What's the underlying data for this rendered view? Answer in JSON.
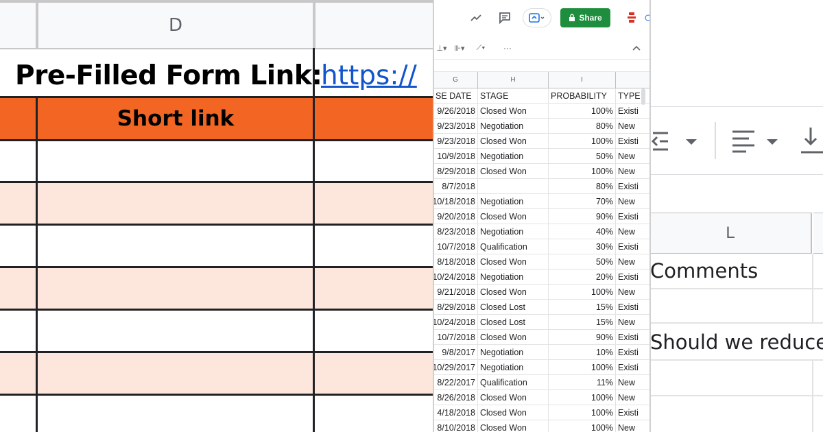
{
  "panel_left": {
    "column_header": "D",
    "title": "Pre-Filled Form Link:",
    "link_text": "https://",
    "header_cell": "Short link",
    "colors": {
      "orange": "#f26522",
      "light_row": "#fde6dc",
      "link": "#1155cc"
    }
  },
  "panel_middle": {
    "share_label": "Share",
    "columns": [
      {
        "letter": "G",
        "header": "SE DATE"
      },
      {
        "letter": "H",
        "header": "STAGE"
      },
      {
        "letter": "I",
        "header": "PROBABILITY"
      },
      {
        "letter": "",
        "header": "TYPE"
      }
    ],
    "rows": [
      {
        "date": "9/26/2018",
        "stage": "Closed Won",
        "prob": "100%",
        "type": "Existi"
      },
      {
        "date": "9/23/2018",
        "stage": "Negotiation",
        "prob": "80%",
        "type": "New"
      },
      {
        "date": "9/23/2018",
        "stage": "Closed Won",
        "prob": "100%",
        "type": "Existi"
      },
      {
        "date": "10/9/2018",
        "stage": "Negotiation",
        "prob": "50%",
        "type": "New"
      },
      {
        "date": "8/29/2018",
        "stage": "Closed Won",
        "prob": "100%",
        "type": "New"
      },
      {
        "date": "8/7/2018",
        "stage": "",
        "prob": "80%",
        "type": "Existi"
      },
      {
        "date": "10/18/2018",
        "stage": "Negotiation",
        "prob": "70%",
        "type": "New"
      },
      {
        "date": "9/20/2018",
        "stage": "Closed Won",
        "prob": "90%",
        "type": "Existi"
      },
      {
        "date": "8/23/2018",
        "stage": "Negotiation",
        "prob": "40%",
        "type": "New"
      },
      {
        "date": "10/7/2018",
        "stage": "Qualification",
        "prob": "30%",
        "type": "Existi"
      },
      {
        "date": "8/18/2018",
        "stage": "Closed Won",
        "prob": "50%",
        "type": "New"
      },
      {
        "date": "10/24/2018",
        "stage": "Negotiation",
        "prob": "20%",
        "type": "Existi"
      },
      {
        "date": "9/21/2018",
        "stage": "Closed Won",
        "prob": "100%",
        "type": "New"
      },
      {
        "date": "8/29/2018",
        "stage": "Closed Lost",
        "prob": "15%",
        "type": "Existi"
      },
      {
        "date": "10/24/2018",
        "stage": "Closed Lost",
        "prob": "15%",
        "type": "New"
      },
      {
        "date": "10/7/2018",
        "stage": "Closed Won",
        "prob": "90%",
        "type": "Existi"
      },
      {
        "date": "9/8/2017",
        "stage": "Negotiation",
        "prob": "10%",
        "type": "Existi"
      },
      {
        "date": "10/29/2017",
        "stage": "Negotiation",
        "prob": "100%",
        "type": "Existi"
      },
      {
        "date": "8/22/2017",
        "stage": "Qualification",
        "prob": "11%",
        "type": "New"
      },
      {
        "date": "8/26/2018",
        "stage": "Closed Won",
        "prob": "100%",
        "type": "New"
      },
      {
        "date": "4/18/2018",
        "stage": "Closed Won",
        "prob": "100%",
        "type": "Existi"
      },
      {
        "date": "8/10/2018",
        "stage": "Closed Won",
        "prob": "100%",
        "type": "New"
      }
    ]
  },
  "panel_right": {
    "column_header": "L",
    "row1": "Comments",
    "row2": "Should we reduce"
  }
}
